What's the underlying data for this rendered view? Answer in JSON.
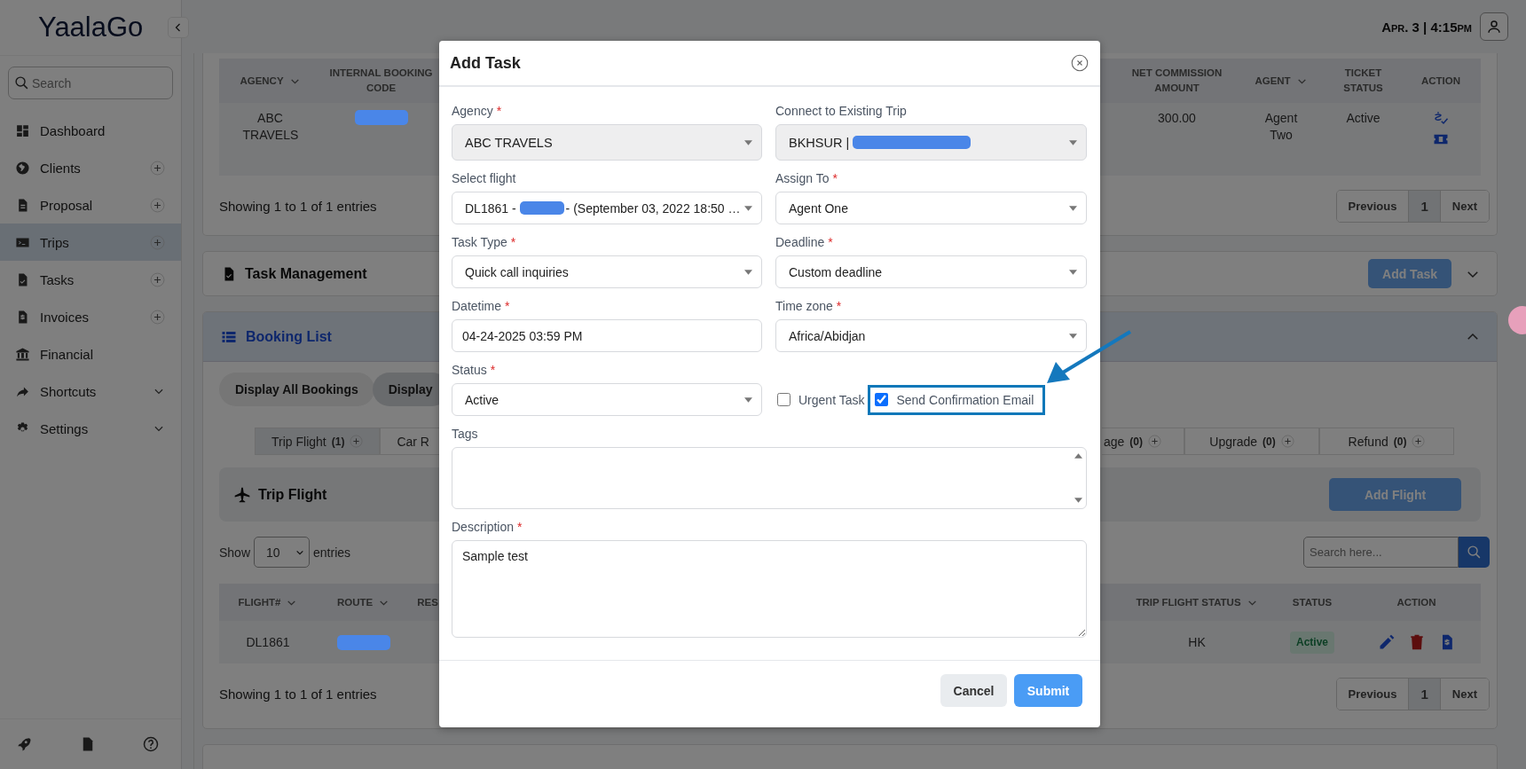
{
  "app": {
    "logo": "YaalaGo",
    "datetime": "Apr. 3 | 4:15pm"
  },
  "sidebar": {
    "search": {
      "placeholder": "Search"
    },
    "items": [
      {
        "label": "Dashboard",
        "kind": "plain",
        "selected": false
      },
      {
        "label": "Clients",
        "kind": "add",
        "selected": false
      },
      {
        "label": "Proposal",
        "kind": "add",
        "selected": false
      },
      {
        "label": "Trips",
        "kind": "add",
        "selected": true
      },
      {
        "label": "Tasks",
        "kind": "add",
        "selected": false
      },
      {
        "label": "Invoices",
        "kind": "add",
        "selected": false
      },
      {
        "label": "Financial",
        "kind": "plain",
        "selected": false
      },
      {
        "label": "Shortcuts",
        "kind": "expand",
        "selected": false
      },
      {
        "label": "Settings",
        "kind": "expand",
        "selected": false
      }
    ]
  },
  "bookings_table": {
    "columns": [
      {
        "label": "AGENCY",
        "sortable": true
      },
      {
        "label": "INTERNAL BOOKING CODE",
        "sortable": false
      },
      {
        "label": "NET COMMISSION AMOUNT",
        "sortable": false
      },
      {
        "label": "AGENT",
        "sortable": true
      },
      {
        "label": "TICKET STATUS",
        "sortable": false
      },
      {
        "label": "ACTION",
        "sortable": false
      }
    ],
    "rows": [
      [
        {
          "kind": "text",
          "text": "ABC TRAVELS"
        },
        {
          "kind": "redacted"
        },
        {
          "kind": "text",
          "text": "300.00"
        },
        {
          "kind": "text",
          "text": "Agent Two"
        },
        {
          "kind": "text",
          "text": "Active"
        },
        {
          "kind": "actions"
        }
      ]
    ],
    "info": "Showing 1 to 1 of 1 entries",
    "pagination": {
      "previous": "Previous",
      "page": "1",
      "next": "Next"
    }
  },
  "task_management": {
    "title": "Task Management",
    "button": "Add Task"
  },
  "booking_list": {
    "title": "Booking List",
    "filters": [
      {
        "label": "Display All Bookings",
        "selected": false
      },
      {
        "label": "Display",
        "selected": true
      }
    ],
    "tabs_left": [
      {
        "label": "Trip Flight",
        "count": "(1)",
        "selected": true
      },
      {
        "label": "Car R",
        "selected": false
      }
    ],
    "tabs_right": [
      {
        "label": "age",
        "count": "(0)",
        "selected": false
      },
      {
        "label": "Upgrade",
        "count": "(0)",
        "selected": false
      },
      {
        "label": "Refund",
        "count": "(0)",
        "selected": false
      }
    ],
    "panel": {
      "title": "Trip Flight",
      "button": "Add Flight"
    },
    "length": {
      "before": "Show",
      "value": "10",
      "after": "entries"
    },
    "search": {
      "placeholder": "Search here..."
    },
    "table": {
      "columns": [
        {
          "label": "FLIGHT#",
          "sortable": true
        },
        {
          "label": "ROUTE",
          "sortable": true
        },
        {
          "label": "RES",
          "sortable": false
        },
        {
          "label": "TRIP FLIGHT STATUS",
          "sortable": true
        },
        {
          "label": "STATUS",
          "sortable": false
        },
        {
          "label": "ACTION",
          "sortable": false
        }
      ],
      "rows": [
        [
          {
            "kind": "text",
            "text": "DL1861"
          },
          {
            "kind": "redacted"
          },
          {
            "kind": "empty"
          },
          {
            "kind": "text",
            "text": "HK"
          },
          {
            "kind": "badge",
            "text": "Active"
          },
          {
            "kind": "actions"
          }
        ]
      ]
    },
    "info": "Showing 1 to 1 of 1 entries",
    "pagination": {
      "previous": "Previous",
      "page": "1",
      "next": "Next"
    }
  },
  "modal": {
    "title": "Add Task",
    "rows": [
      {
        "fields": [
          {
            "label": "Agency",
            "required_mark": "*",
            "kind": "select",
            "value": "ABC TRAVELS",
            "disabled": true
          },
          {
            "label": "Connect to Existing Trip",
            "kind": "select",
            "value": "BKHSUR |",
            "redacted": true,
            "disabled": true
          }
        ]
      },
      {
        "fields": [
          {
            "label": "Select flight",
            "kind": "select",
            "value": "DL1861 -",
            "redacted": true,
            "value_after": "- (September 03, 2022 18:50 …",
            "disabled": false
          },
          {
            "label": "Assign To",
            "required_mark": "*",
            "kind": "select",
            "value": "Agent One",
            "disabled": false
          }
        ]
      },
      {
        "fields": [
          {
            "label": "Task Type",
            "required_mark": "*",
            "kind": "select",
            "value": "Quick call inquiries",
            "disabled": false
          },
          {
            "label": "Deadline",
            "required_mark": "*",
            "kind": "select",
            "value": "Custom deadline",
            "disabled": false
          }
        ]
      },
      {
        "fields": [
          {
            "label": "Datetime",
            "required_mark": "*",
            "kind": "input",
            "value": "04-24-2025 03:59 PM"
          },
          {
            "label": "Time zone",
            "required_mark": "*",
            "kind": "select",
            "value": "Africa/Abidjan",
            "disabled": false
          }
        ]
      },
      {
        "fields": [
          {
            "label": "Status",
            "required_mark": "*",
            "kind": "select",
            "value": "Active",
            "disabled": false
          },
          {
            "kind": "checks",
            "options": [
              {
                "label": "Urgent Task",
                "checked": false,
                "highlighted": false
              },
              {
                "label": "Send Confirmation Email",
                "checked": true,
                "highlighted": true
              }
            ]
          }
        ]
      },
      {
        "fields": [
          {
            "label": "Tags",
            "kind": "list"
          }
        ]
      },
      {
        "fields": [
          {
            "label": "Description",
            "required_mark": "*",
            "kind": "textarea",
            "value": "Sample test"
          }
        ]
      }
    ],
    "buttons": [
      {
        "label": "Cancel",
        "kind": "secondary"
      },
      {
        "label": "Submit",
        "kind": "primary"
      }
    ]
  }
}
